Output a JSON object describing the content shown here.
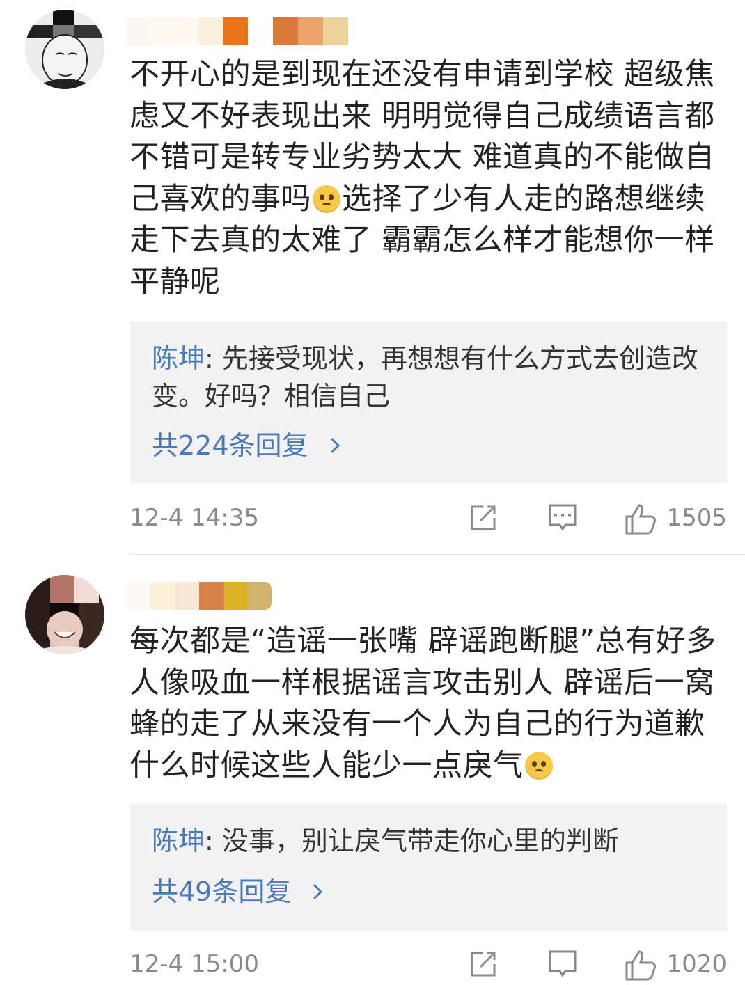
{
  "comments": [
    {
      "text_a": "不开心的是到现在还没有申请到学校 超级焦虑又不好表现出来 明明觉得自己成绩语言都不错可是转专业劣势太大 难道真的不能做自己喜欢的事吗",
      "text_b": "选择了少有人走的路想继续走下去真的太难了 霸霸怎么样才能想你一样平静呢",
      "reply_author": "陈坤",
      "reply_sep": ": ",
      "reply_text": "先接受现状，再想想有什么方式去创造改变。好吗？相信自己",
      "reply_count": "共224条回复",
      "time": "12-4 14:35",
      "likes": "1505"
    },
    {
      "text_a": "每次都是“造谣一张嘴 辟谣跑断腿”总有好多人像吸血一样根据谣言攻击别人 辟谣后一窝蜂的走了从来没有一个人为自己的行为道歉 什么时候这些人能少一点戾气",
      "reply_author": "陈坤",
      "reply_sep": ": ",
      "reply_text": "没事，别让戾气带走你心里的判断",
      "reply_count": "共49条回复",
      "time": "12-4 15:00",
      "likes": "1020"
    }
  ],
  "icons": {
    "share": "share-icon",
    "comment": "comment-icon",
    "like": "thumbs-up-icon",
    "chevron": "chevron-right-icon",
    "emoji": "worried-face-emoji"
  },
  "colors": {
    "link": "#4a7ab8",
    "meta": "#8a8a8a",
    "reply_bg": "#f2f2f2"
  }
}
